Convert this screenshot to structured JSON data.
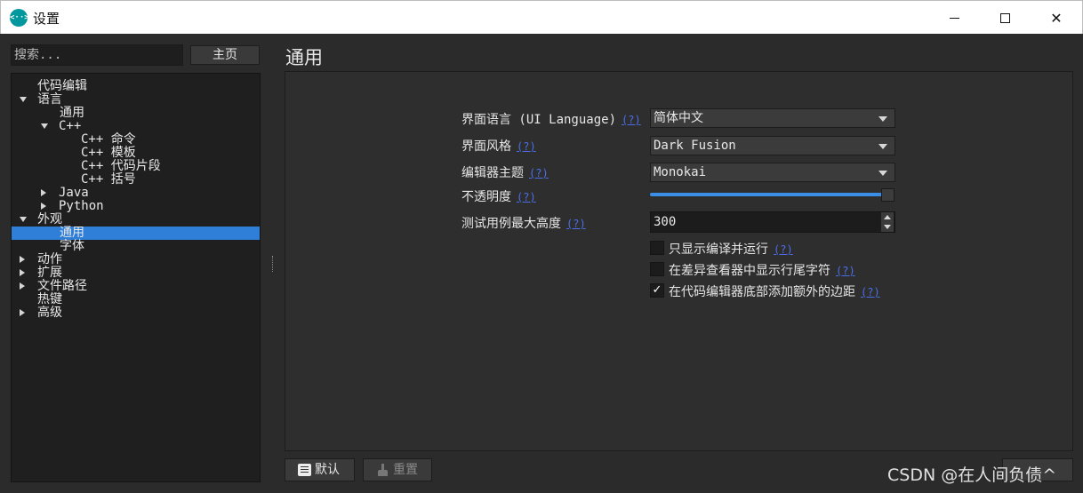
{
  "window": {
    "title": "设置",
    "app_icon_text": "<··>",
    "minimize_icon": "minimize-icon",
    "maximize_icon": "maximize-icon",
    "close_icon": "close-icon",
    "close_glyph": "✕"
  },
  "sidebar": {
    "search_placeholder": "搜索...",
    "home_label": "主页",
    "items": [
      {
        "label": "代码编辑",
        "expander": "none"
      },
      {
        "label": "语言",
        "expander": "down"
      },
      {
        "label": "通用",
        "expander": "none"
      },
      {
        "label": "C++",
        "expander": "down"
      },
      {
        "label": "C++ 命令",
        "expander": "none"
      },
      {
        "label": "C++ 模板",
        "expander": "none"
      },
      {
        "label": "C++ 代码片段",
        "expander": "none"
      },
      {
        "label": "C++ 括号",
        "expander": "none"
      },
      {
        "label": "Java",
        "expander": "right"
      },
      {
        "label": "Python",
        "expander": "right"
      },
      {
        "label": "外观",
        "expander": "down"
      },
      {
        "label": "通用",
        "expander": "none",
        "selected": true
      },
      {
        "label": "字体",
        "expander": "none"
      },
      {
        "label": "动作",
        "expander": "right"
      },
      {
        "label": "扩展",
        "expander": "right"
      },
      {
        "label": "文件路径",
        "expander": "right"
      },
      {
        "label": "热键",
        "expander": "none"
      },
      {
        "label": "高级",
        "expander": "right"
      }
    ]
  },
  "main": {
    "title": "通用",
    "help_text": "(?)",
    "ui_language": {
      "label": "界面语言 (UI Language)",
      "value": "简体中文"
    },
    "ui_style": {
      "label": "界面风格",
      "value": "Dark Fusion"
    },
    "editor_theme": {
      "label": "编辑器主题",
      "value": "Monokai"
    },
    "opacity": {
      "label": "不透明度",
      "value_fraction": 1.0
    },
    "testcase_height": {
      "label": "测试用例最大高度",
      "value": "300"
    },
    "checkboxes": [
      {
        "label": "只显示编译并运行",
        "checked": false
      },
      {
        "label": "在差异查看器中显示行尾字符",
        "checked": false
      },
      {
        "label": "在代码编辑器底部添加额外的边距",
        "checked": true
      }
    ],
    "check_glyph": "✓"
  },
  "footer": {
    "default_label": "默认",
    "reset_label": "重置",
    "watermark": "CSDN @在人间负债^"
  },
  "colors": {
    "selection": "#2f7fd8",
    "slider": "#3a8ee6",
    "link": "#4a6fe8",
    "app_icon": "#00979d"
  }
}
